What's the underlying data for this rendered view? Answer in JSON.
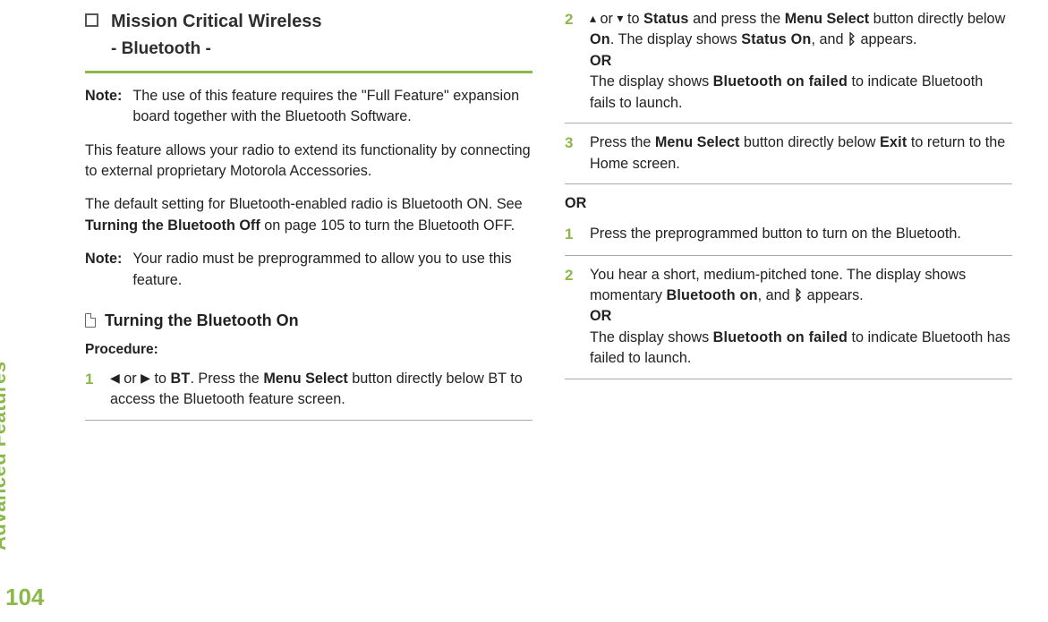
{
  "sidebar": {
    "label": "Advanced Features",
    "page_number": "104"
  },
  "left": {
    "title_main": "Mission Critical Wireless",
    "title_sub": "- Bluetooth -",
    "note1_label": "Note:",
    "note1_text": "The use of this feature requires the \"Full Feature\" expansion board together with the Bluetooth Software.",
    "para1": "This feature allows your radio to extend its functionality by connecting to external proprietary Motorola Accessories.",
    "para2_a": "The default setting for Bluetooth-enabled radio is Bluetooth ON. See ",
    "para2_bold": "Turning the Bluetooth Off",
    "para2_b": " on page 105 to turn the Bluetooth OFF.",
    "note2_label": "Note:",
    "note2_text": "Your radio must be preprogrammed to allow you to use this feature.",
    "subhead": "Turning the Bluetooth On",
    "proc_label": "Procedure:",
    "step1": {
      "num": "1",
      "a": " or ",
      "b": " to ",
      "bt": "BT",
      "c": ". Press the ",
      "menu": "Menu Select",
      "d": " button directly below BT to access the Bluetooth feature screen."
    }
  },
  "right": {
    "step2": {
      "num": "2",
      "a": " or ",
      "b": " to ",
      "status": "Status",
      "c": " and press the ",
      "menu": "Menu Select",
      "d": " button directly below ",
      "on": "On",
      "e": ". The display shows ",
      "statuson": "Status On",
      "f": ", and ",
      "g": " appears.",
      "or": "OR",
      "h": "The display shows ",
      "fail": "Bluetooth on failed",
      "i": " to indicate Bluetooth fails to launch."
    },
    "step3": {
      "num": "3",
      "a": "Press the ",
      "menu": "Menu Select",
      "b": " button directly below ",
      "exit": "Exit",
      "c": " to return to the Home screen."
    },
    "or_label": "OR",
    "alt1": {
      "num": "1",
      "text": "Press the preprogrammed button to turn on the Bluetooth."
    },
    "alt2": {
      "num": "2",
      "a": "You hear a short, medium-pitched tone. The display shows momentary ",
      "bton": "Bluetooth on",
      "b": ", and ",
      "c": " appears.",
      "or": "OR",
      "d": "The display shows ",
      "fail": "Bluetooth on failed",
      "e": " to indicate Bluetooth has failed to launch."
    }
  }
}
